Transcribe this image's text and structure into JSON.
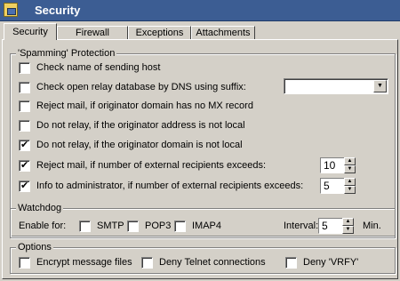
{
  "window": {
    "title": "Security"
  },
  "tabs": [
    {
      "label": "Security",
      "active": true
    },
    {
      "label": "Firewall",
      "active": false
    },
    {
      "label": "Exceptions",
      "active": false
    },
    {
      "label": "Attachments",
      "active": false
    }
  ],
  "spam": {
    "label": "'Spamming' Protection",
    "items": [
      {
        "label": "Check name of sending host",
        "checked": false
      },
      {
        "label": "Check open relay database by DNS using suffix:",
        "checked": false
      },
      {
        "label": "Reject mail, if originator domain has no MX record",
        "checked": false
      },
      {
        "label": "Do not relay, if the originator address is not local",
        "checked": false
      },
      {
        "label": "Do not relay, if the originator domain is not local",
        "checked": true
      },
      {
        "label": "Reject mail, if number of external recipients exceeds:",
        "checked": true
      },
      {
        "label": "Info to administrator, if number of external recipients exceeds:",
        "checked": true
      }
    ],
    "dns_suffix_value": "",
    "reject_limit": "10",
    "info_limit": "5"
  },
  "watchdog": {
    "label": "Watchdog",
    "enable_label": "Enable for:",
    "protocols": [
      {
        "label": "SMTP",
        "checked": false
      },
      {
        "label": "POP3",
        "checked": false
      },
      {
        "label": "IMAP4",
        "checked": false
      }
    ],
    "interval_label": "Interval:",
    "interval_value": "5",
    "interval_unit": "Min."
  },
  "options": {
    "label": "Options",
    "items": [
      {
        "label": "Encrypt message files",
        "checked": false
      },
      {
        "label": "Deny Telnet connections",
        "checked": false
      },
      {
        "label": "Deny 'VRFY'",
        "checked": false
      }
    ]
  }
}
